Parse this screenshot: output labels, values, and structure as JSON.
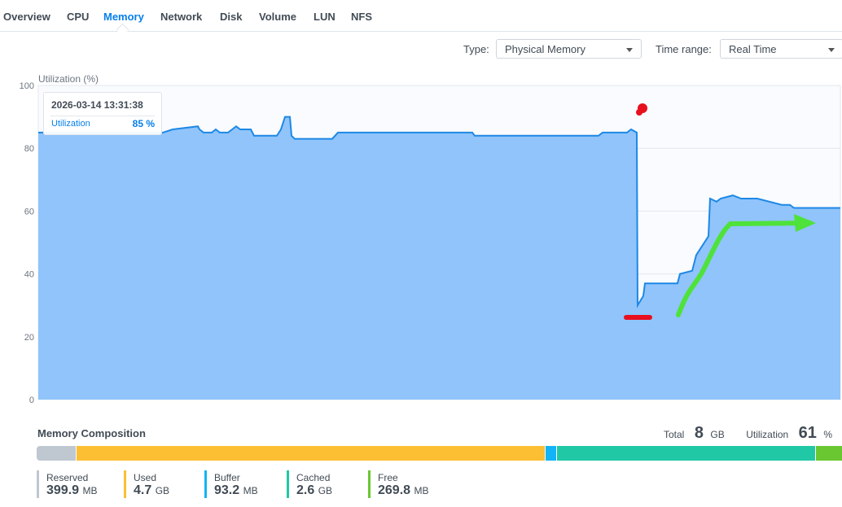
{
  "tabs": [
    {
      "label": "Overview"
    },
    {
      "label": "CPU"
    },
    {
      "label": "Memory",
      "active": true
    },
    {
      "label": "Network"
    },
    {
      "label": "Disk"
    },
    {
      "label": "Volume"
    },
    {
      "label": "LUN"
    },
    {
      "label": "NFS"
    }
  ],
  "filters": {
    "type_label": "Type:",
    "type_value": "Physical Memory",
    "range_label": "Time range:",
    "range_value": "Real Time"
  },
  "tooltip": {
    "datetime": "2026-03-14 13:31:38",
    "key": "Utilization",
    "value": "85 %"
  },
  "chart_data": {
    "type": "area",
    "ylabel": "Utilization (%)",
    "ylim": [
      0,
      100
    ],
    "yticks": [
      0,
      20,
      40,
      60,
      80,
      100
    ],
    "series_color": "#1e88e5",
    "fill_color": "#90c4fb",
    "x": [
      0,
      153,
      165,
      196,
      198,
      203,
      213,
      218,
      223,
      233,
      243,
      248,
      261,
      265,
      293,
      298,
      303,
      309,
      311,
      315,
      361,
      368,
      533,
      536,
      688,
      693,
      723,
      728,
      735,
      736,
      743,
      745,
      785,
      788,
      803,
      808,
      813,
      823,
      825,
      833,
      838,
      853,
      863,
      883,
      913,
      923,
      928,
      985
    ],
    "y": [
      85,
      85,
      86,
      87,
      86,
      85,
      85,
      86,
      85,
      85,
      87,
      86,
      86,
      84,
      84,
      86,
      90,
      90,
      84,
      83,
      83,
      85,
      85,
      84,
      84,
      85,
      85,
      86,
      85,
      30,
      33,
      37,
      37,
      40,
      41,
      46,
      48,
      52,
      64,
      63,
      64,
      65,
      64,
      64,
      62,
      62,
      61,
      61
    ]
  },
  "composition": {
    "title": "Memory Composition",
    "total_label": "Total",
    "total_value": "8",
    "total_unit": "GB",
    "util_label": "Utilization",
    "util_value": "61",
    "util_unit": "%",
    "items": [
      {
        "name": "Reserved",
        "value": "399.9",
        "unit": "MB",
        "color": "#bfc8d1",
        "share": 4.9
      },
      {
        "name": "Used",
        "value": "4.7",
        "unit": "GB",
        "color": "#fcbf34",
        "share": 58.5
      },
      {
        "name": "Buffer",
        "value": "93.2",
        "unit": "MB",
        "color": "#12b4f7",
        "share": 1.3
      },
      {
        "name": "Cached",
        "value": "2.6",
        "unit": "GB",
        "color": "#21c8a6",
        "share": 32.2
      },
      {
        "name": "Free",
        "value": "269.8",
        "unit": "MB",
        "color": "#6ac732",
        "share": 3.3
      }
    ]
  }
}
